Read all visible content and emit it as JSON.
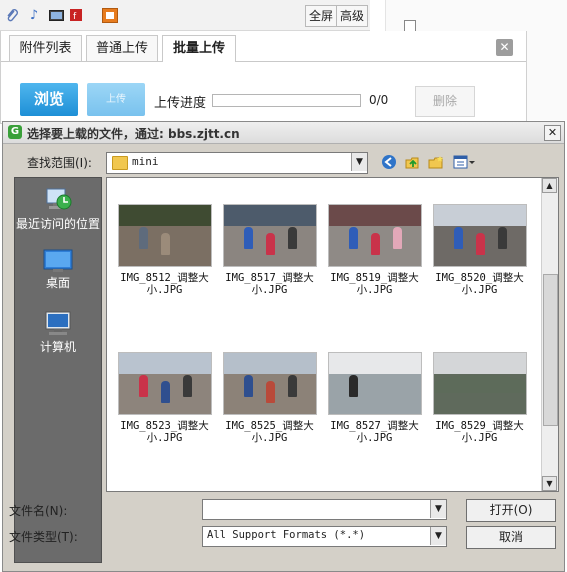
{
  "toolbar": {
    "icons": [
      "attachment-icon",
      "music-icon",
      "video-icon",
      "flash-icon",
      "image-upload-icon"
    ],
    "fullscreen_label": "全屏",
    "advanced_label": "高级"
  },
  "upload_panel": {
    "tabs": [
      {
        "label": "附件列表",
        "active": false
      },
      {
        "label": "普通上传",
        "active": false
      },
      {
        "label": "批量上传",
        "active": true
      }
    ],
    "close_symbol": "✕",
    "browse_label": "浏览",
    "upload_label": "上传",
    "progress_label": "上传进度",
    "progress_fraction": 0,
    "progress_count": "0/0",
    "delete_label": "删除"
  },
  "dialog": {
    "title": "选择要上载的文件，通过: bbs.zjtt.cn",
    "look_in_label": "查找范围(I):",
    "look_in_value": "mini",
    "places": [
      {
        "label": "最近访问的位置",
        "icon": "recent-places-icon"
      },
      {
        "label": "桌面",
        "icon": "desktop-icon"
      },
      {
        "label": "计算机",
        "icon": "computer-icon"
      }
    ],
    "files": [
      {
        "name": "IMG_8512_调整大小.JPG"
      },
      {
        "name": "IMG_8517_调整大小.JPG"
      },
      {
        "name": "IMG_8519_调整大小.JPG"
      },
      {
        "name": "IMG_8520_调整大小.JPG"
      },
      {
        "name": "IMG_8523_调整大小.JPG"
      },
      {
        "name": "IMG_8525_调整大小.JPG"
      },
      {
        "name": "IMG_8527_调整大小.JPG"
      },
      {
        "name": "IMG_8529_调整大小.JPG"
      }
    ],
    "file_name_label": "文件名(N):",
    "file_name_value": "",
    "file_type_label": "文件类型(T):",
    "file_type_value": "All Support Formats (*.*)",
    "open_label": "打开(O)",
    "cancel_label": "取消"
  },
  "colors": {
    "accent_blue": "#1e8fd6",
    "places_bg": "#6b6b6b",
    "dialog_bg": "#d4d0c8"
  }
}
